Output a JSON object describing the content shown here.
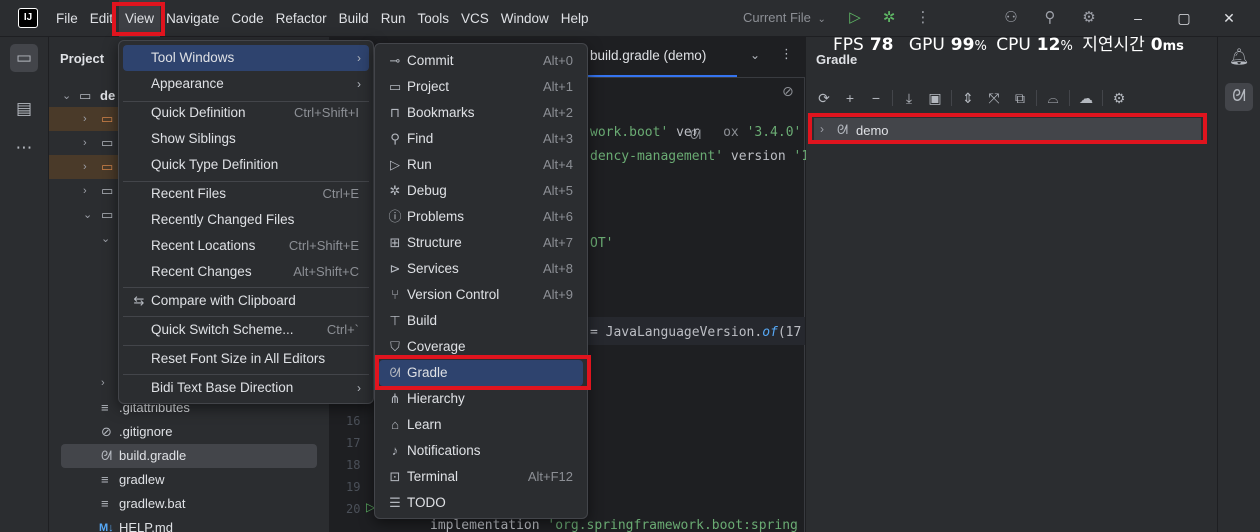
{
  "menubar": {
    "items": [
      "File",
      "Edit",
      "View",
      "Navigate",
      "Code",
      "Refactor",
      "Build",
      "Run",
      "Tools",
      "VCS",
      "Window",
      "Help"
    ]
  },
  "titlebar": {
    "app_logo": "IJ",
    "run_config": "Current File"
  },
  "overlay": {
    "fps_label": "FPS",
    "fps_value": "78",
    "gpu_label": "GPU",
    "gpu_value": "99",
    "gpu_unit": "%",
    "cpu_label": "CPU",
    "cpu_value": "12",
    "cpu_unit": "%",
    "latency_label": "지연시간",
    "latency_value": "0",
    "latency_unit": "ms"
  },
  "project": {
    "title": "Project",
    "root": "de",
    "files": [
      {
        "name": ".gitattributes",
        "icon": "lines-icon"
      },
      {
        "name": ".gitignore",
        "icon": "no-icon"
      },
      {
        "name": "build.gradle",
        "icon": "gradle-icon"
      },
      {
        "name": "gradlew",
        "icon": "lines-icon"
      },
      {
        "name": "gradlew.bat",
        "icon": "lines-icon"
      },
      {
        "name": "HELP.md",
        "icon": "markdown-icon"
      }
    ]
  },
  "editor": {
    "tab": "build.gradle (demo)",
    "lines": [
      {
        "parts": [
          [
            "str",
            "work.boot'"
          ],
          [
            "plain",
            " ver"
          ],
          [
            "plain",
            "   "
          ],
          [
            "plain",
            "ox"
          ],
          [
            "plain",
            " "
          ],
          [
            "str",
            "'3.4.0'"
          ]
        ]
      },
      {
        "parts": [
          [
            "str",
            "dency-management'"
          ],
          [
            "plain",
            " version "
          ],
          [
            "str",
            "'1"
          ]
        ]
      },
      {
        "parts": [
          [
            "str",
            "OT'"
          ]
        ]
      },
      {
        "parts": [
          [
            "plain",
            "= JavaLanguageVersion."
          ],
          [
            "ital",
            "of"
          ],
          [
            "plain",
            "(17"
          ]
        ]
      },
      {
        "parts": [
          [
            "plain",
            "implementation "
          ],
          [
            "str",
            "'org.springframework.boot:spring"
          ]
        ]
      }
    ],
    "line_numbers": [
      "16",
      "17",
      "18",
      "19",
      "20"
    ]
  },
  "gradle": {
    "title": "Gradle",
    "root": "demo"
  },
  "view_menu": {
    "items": [
      {
        "label": "Tool Windows",
        "shortcut": "",
        "submenu": true,
        "highlighted": true
      },
      {
        "label": "Appearance",
        "shortcut": "",
        "submenu": true
      },
      {
        "label": "Quick Definition",
        "shortcut": "Ctrl+Shift+I"
      },
      {
        "label": "Show Siblings",
        "shortcut": ""
      },
      {
        "label": "Quick Type Definition",
        "shortcut": ""
      },
      {
        "label": "Recent Files",
        "shortcut": "Ctrl+E"
      },
      {
        "label": "Recently Changed Files",
        "shortcut": ""
      },
      {
        "label": "Recent Locations",
        "shortcut": "Ctrl+Shift+E"
      },
      {
        "label": "Recent Changes",
        "shortcut": "Alt+Shift+C"
      },
      {
        "label": "Compare with Clipboard",
        "shortcut": ""
      },
      {
        "label": "Quick Switch Scheme...",
        "shortcut": "Ctrl+`"
      },
      {
        "label": "Reset Font Size in All Editors",
        "shortcut": ""
      },
      {
        "label": "Bidi Text Base Direction",
        "shortcut": "",
        "submenu": true
      }
    ]
  },
  "tool_windows_menu": {
    "items": [
      {
        "label": "Commit",
        "shortcut": "Alt+0",
        "icon": "commit-icon"
      },
      {
        "label": "Project",
        "shortcut": "Alt+1",
        "icon": "folder-icon"
      },
      {
        "label": "Bookmarks",
        "shortcut": "Alt+2",
        "icon": "bookmark-icon"
      },
      {
        "label": "Find",
        "shortcut": "Alt+3",
        "icon": "search-icon"
      },
      {
        "label": "Run",
        "shortcut": "Alt+4",
        "icon": "run-icon"
      },
      {
        "label": "Debug",
        "shortcut": "Alt+5",
        "icon": "debug-icon"
      },
      {
        "label": "Problems",
        "shortcut": "Alt+6",
        "icon": "problems-icon"
      },
      {
        "label": "Structure",
        "shortcut": "Alt+7",
        "icon": "structure-icon"
      },
      {
        "label": "Services",
        "shortcut": "Alt+8",
        "icon": "services-icon"
      },
      {
        "label": "Version Control",
        "shortcut": "Alt+9",
        "icon": "vcs-icon"
      },
      {
        "label": "Build",
        "shortcut": "",
        "icon": "build-icon"
      },
      {
        "label": "Coverage",
        "shortcut": "",
        "icon": "coverage-icon"
      },
      {
        "label": "Gradle",
        "shortcut": "",
        "icon": "gradle-icon",
        "highlighted": true
      },
      {
        "label": "Hierarchy",
        "shortcut": "",
        "icon": "hierarchy-icon"
      },
      {
        "label": "Learn",
        "shortcut": "",
        "icon": "learn-icon"
      },
      {
        "label": "Notifications",
        "shortcut": "",
        "icon": "bell-icon"
      },
      {
        "label": "Terminal",
        "shortcut": "Alt+F12",
        "icon": "terminal-icon"
      },
      {
        "label": "TODO",
        "shortcut": "",
        "icon": "todo-icon"
      }
    ]
  },
  "colors": {
    "highlight": "#2e436e",
    "annotation": "#e0141e",
    "accent": "#3574f0"
  }
}
